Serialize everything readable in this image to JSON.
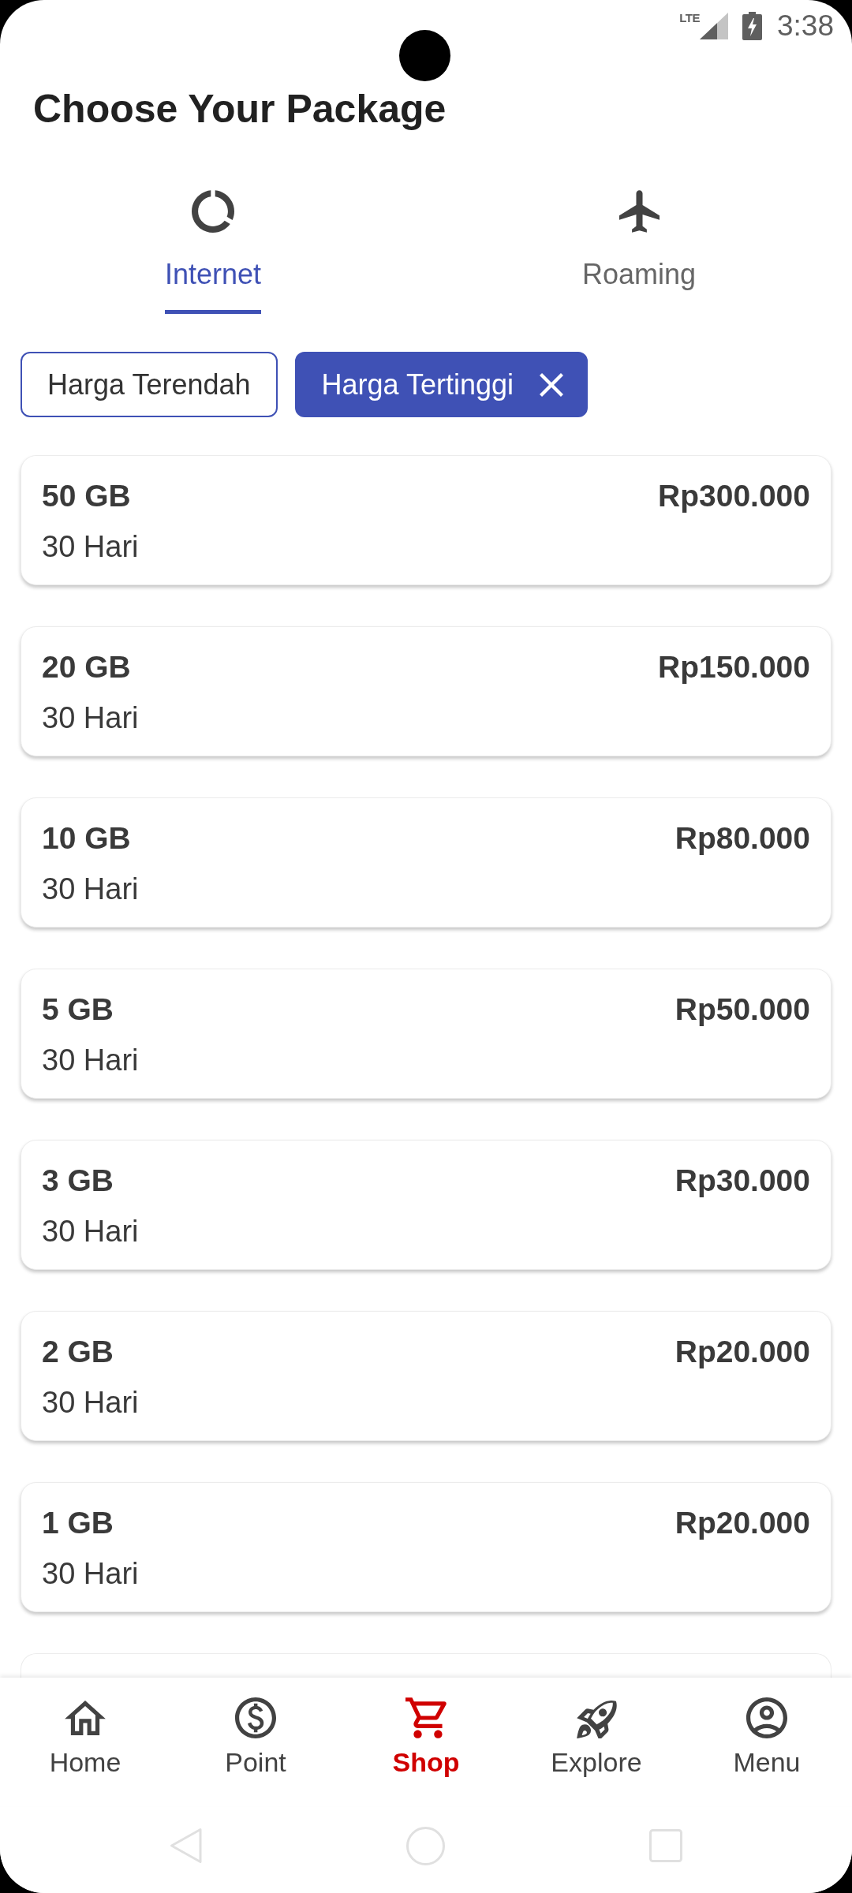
{
  "status_bar": {
    "network": "LTE",
    "time": "3:38"
  },
  "header": {
    "title": "Choose Your Package"
  },
  "tabs": [
    {
      "label": "Internet",
      "selected": true
    },
    {
      "label": "Roaming",
      "selected": false
    }
  ],
  "filters": [
    {
      "label": "Harga Terendah",
      "selected": false
    },
    {
      "label": "Harga Tertinggi",
      "selected": true
    }
  ],
  "packages": [
    {
      "kind": "package",
      "quota": "50 GB",
      "validity": "30 Hari",
      "price": "Rp300.000"
    },
    {
      "kind": "package",
      "quota": "20 GB",
      "validity": "30 Hari",
      "price": "Rp150.000"
    },
    {
      "kind": "package",
      "quota": "10 GB",
      "validity": "30 Hari",
      "price": "Rp80.000"
    },
    {
      "kind": "package",
      "quota": "5 GB",
      "validity": "30 Hari",
      "price": "Rp50.000"
    },
    {
      "kind": "package",
      "quota": "3 GB",
      "validity": "30 Hari",
      "price": "Rp30.000"
    },
    {
      "kind": "package",
      "quota": "2 GB",
      "validity": "30 Hari",
      "price": "Rp20.000"
    },
    {
      "kind": "package",
      "quota": "1 GB",
      "validity": "30 Hari",
      "price": "Rp20.000"
    },
    {
      "kind": "partial"
    }
  ],
  "bottom_nav": [
    {
      "label": "Home",
      "selected": false
    },
    {
      "label": "Point",
      "selected": false
    },
    {
      "label": "Shop",
      "selected": true
    },
    {
      "label": "Explore",
      "selected": false
    },
    {
      "label": "Menu",
      "selected": false
    }
  ]
}
